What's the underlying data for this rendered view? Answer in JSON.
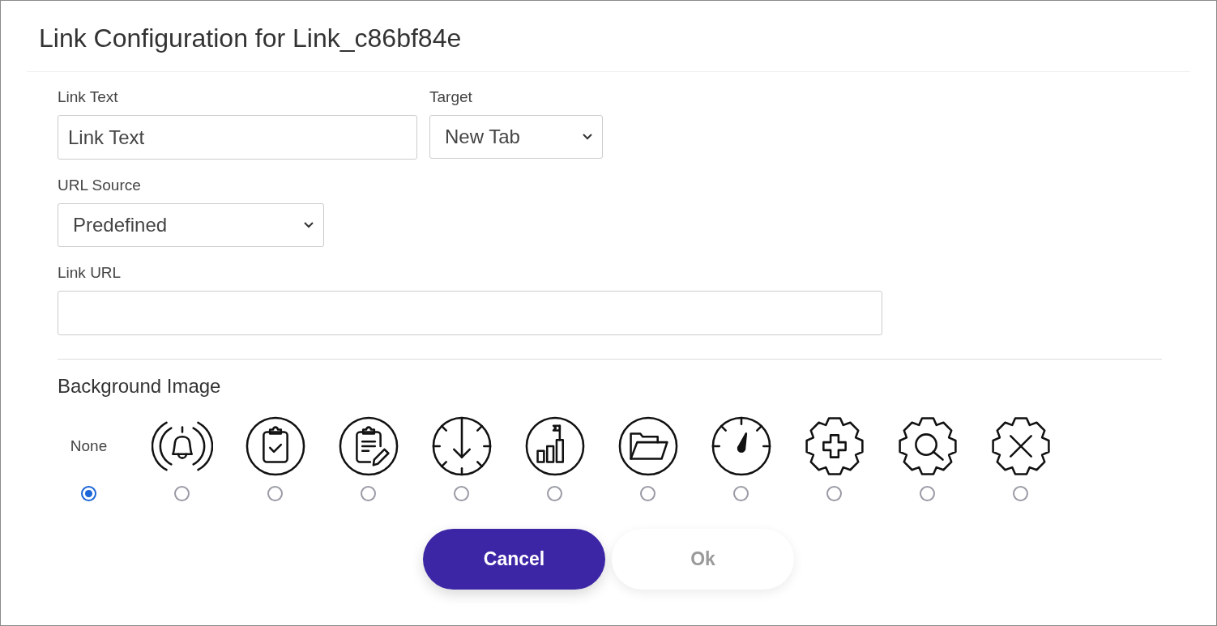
{
  "dialog": {
    "title": "Link Configuration for Link_c86bf84e"
  },
  "form": {
    "link_text": {
      "label": "Link Text",
      "value": "Link Text"
    },
    "target": {
      "label": "Target",
      "value": "New Tab"
    },
    "url_source": {
      "label": "URL Source",
      "value": "Predefined"
    },
    "link_url": {
      "label": "Link URL"
    }
  },
  "background_image": {
    "heading": "Background Image",
    "options": [
      {
        "kind": "none",
        "label": "None",
        "selected": true
      },
      {
        "kind": "bell",
        "selected": false
      },
      {
        "kind": "clipboard-check",
        "selected": false
      },
      {
        "kind": "clipboard-edit",
        "selected": false
      },
      {
        "kind": "dial-arrow",
        "selected": false
      },
      {
        "kind": "chart-flag",
        "selected": false
      },
      {
        "kind": "folder",
        "selected": false
      },
      {
        "kind": "gauge",
        "selected": false
      },
      {
        "kind": "gear-plus",
        "selected": false
      },
      {
        "kind": "gear-search",
        "selected": false
      },
      {
        "kind": "gear-x",
        "selected": false
      }
    ]
  },
  "buttons": [
    {
      "label": "Cancel",
      "kind": "primary",
      "disabled": false
    },
    {
      "label": "Ok",
      "kind": "secondary",
      "disabled": true
    }
  ]
}
